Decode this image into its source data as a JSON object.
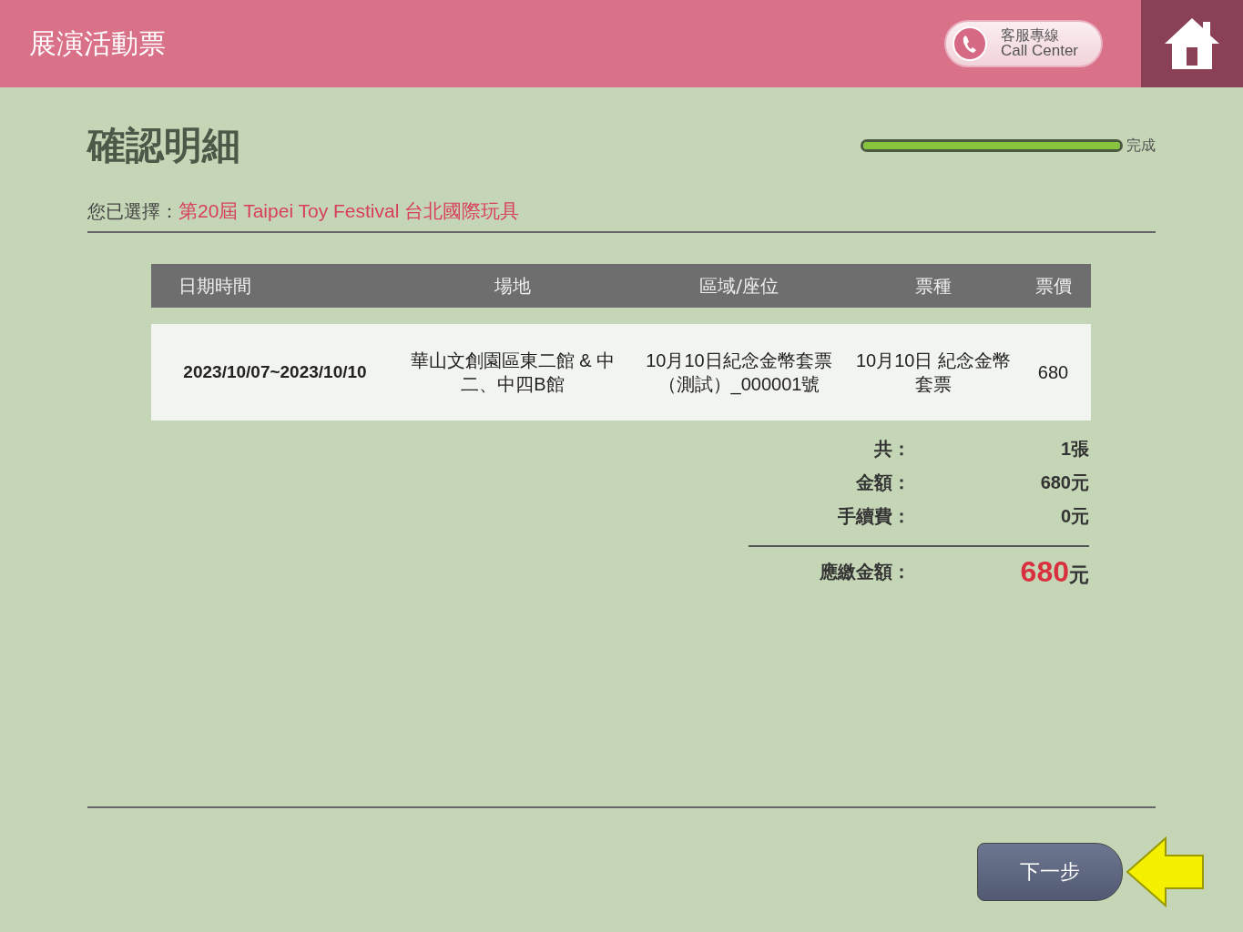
{
  "header": {
    "title": "展演活動票",
    "call_center": {
      "label_zh": "客服專線",
      "label_en": "Call Center"
    }
  },
  "page_title": "確認明細",
  "progress": {
    "level": 1,
    "label": "完成"
  },
  "selection": {
    "label": "您已選擇：",
    "event": "第20屆 Taipei Toy Festival 台北國際玩具"
  },
  "table": {
    "columns": [
      "日期時間",
      "場地",
      "區域/座位",
      "票種",
      "票價"
    ],
    "rows": [
      {
        "cells": [
          "2023/10/07~2023/10/10",
          "華山文創園區東二館 & 中二、中四B館",
          "10月10日紀念金幣套票（測試）_000001號",
          "10月10日 紀念金幣套票",
          "680"
        ]
      }
    ]
  },
  "summary": [
    {
      "label": "共：",
      "value": "1張"
    },
    {
      "label": "金額：",
      "value": "680元"
    },
    {
      "label": "手續費：",
      "value": "0元"
    }
  ],
  "total": {
    "label": "應繳金額：",
    "amount": "680",
    "unit": "元"
  },
  "next_button": "下一步"
}
